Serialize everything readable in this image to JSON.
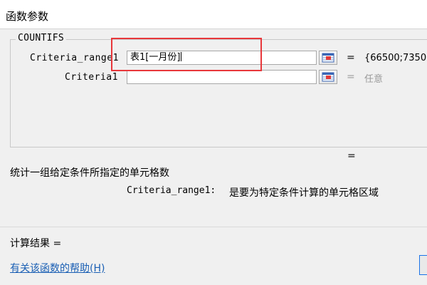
{
  "window": {
    "title": "函数参数"
  },
  "function": {
    "name": "COUNTIFS"
  },
  "args": [
    {
      "label": "Criteria_range1",
      "value": "表1[一月份]",
      "result": "{66500;7350"
    },
    {
      "label": "Criteria1",
      "value": "",
      "result": "任意"
    }
  ],
  "summary": {
    "equals": "=",
    "description": "统计一组给定条件所指定的单元格数",
    "arg_name": "Criteria_range1:",
    "arg_description": "是要为特定条件计算的单元格区域"
  },
  "footer": {
    "calc_result_label": "计算结果 =",
    "help_link": "有关该函数的帮助(H)"
  },
  "colors": {
    "highlight": "#e8373b",
    "link": "#1a5fb4"
  },
  "icons": {
    "ref_button": "collapse-dialog-icon"
  }
}
